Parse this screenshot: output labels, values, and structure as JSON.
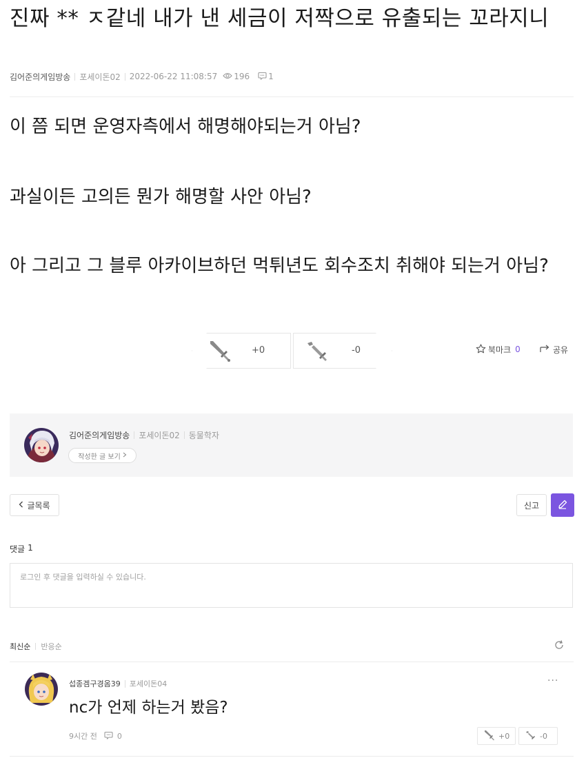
{
  "post": {
    "title": "진짜 ** ㅈ같네 내가 낸 세금이 저짝으로 유출되는 꼬라지니",
    "author": "김어준의게임방송",
    "server": "포세이돈02",
    "datetime": "2022-06-22 11:08:57",
    "views": "196",
    "comment_count": "1",
    "paragraphs": [
      "이 쯤 되면 운영자측에서 해명해야되는거 아님?",
      "과실이든 고의든 뭔가 해명할 사안 아님?",
      "아 그리고 그 블루 아카이브하던 먹튀년도 회수조치 취해야 되는거 아님?"
    ],
    "upvote": "+0",
    "downvote": "-0",
    "bookmark_label": "북마크",
    "bookmark_count": "0",
    "share_label": "공유"
  },
  "author_card": {
    "name": "김어준의게임방송",
    "server": "포세이돈02",
    "job": "동물학자",
    "view_posts_label": "작성한 글 보기"
  },
  "actions": {
    "list_label": "글목록",
    "report_label": "신고"
  },
  "comments_section": {
    "heading": "댓글",
    "count": "1",
    "placeholder": "로그인 후 댓글을 입력하실 수 있습니다.",
    "sort_latest": "최신순",
    "sort_reaction": "반응순"
  },
  "comments": [
    {
      "author": "섭종겜구경옴39",
      "server": "포세이돈04",
      "text": "nc가 언제 하는거 봤음?",
      "time": "9시간 전",
      "replies": "0",
      "upvote": "+0",
      "downvote": "-0"
    }
  ],
  "colors": {
    "accent": "#7b55e0",
    "card_bg": "#f5f5f6",
    "muted_text": "#9a9a9a"
  },
  "icons": [
    "eye-icon",
    "comment-icon",
    "sword-up-icon",
    "sword-down-icon",
    "star-icon",
    "share-icon",
    "chevron-left-icon",
    "chevron-right-icon",
    "pencil-icon",
    "refresh-icon",
    "more-icon"
  ]
}
